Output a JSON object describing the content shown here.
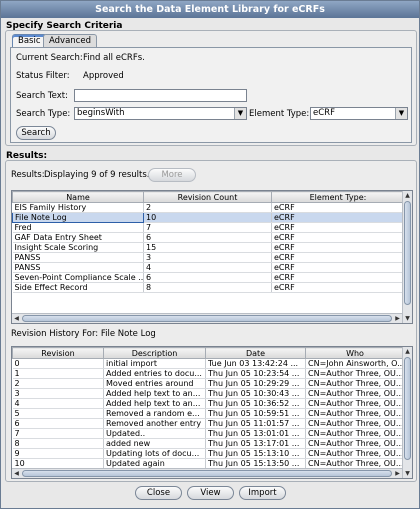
{
  "window": {
    "title": "Search the Data Element Library for eCRFs"
  },
  "criteria": {
    "title": "Specify Search Criteria",
    "tabs": [
      {
        "label": "Basic"
      },
      {
        "label": "Advanced"
      }
    ],
    "current_search_label": "Current Search:",
    "current_search_value": "Find all eCRFs.",
    "status_filter_label": "Status Filter:",
    "status_filter_value": "Approved",
    "search_text_label": "Search Text:",
    "search_text_value": "",
    "search_type_label": "Search Type:",
    "search_type_value": "beginsWith",
    "element_type_label": "Element Type:",
    "element_type_value": "eCRF",
    "search_button": "Search"
  },
  "results": {
    "title": "Results:",
    "summary_label": "Results:",
    "summary_value": "Displaying 9 of 9 results.",
    "more_button": "More",
    "columns": [
      "Name",
      "Revision Count",
      "Element Type:"
    ],
    "rows": [
      [
        "EIS Family History",
        "2",
        "eCRF"
      ],
      [
        "File Note Log",
        "10",
        "eCRF"
      ],
      [
        "Fred",
        "7",
        "eCRF"
      ],
      [
        "GAF Data Entry Sheet",
        "6",
        "eCRF"
      ],
      [
        "Insight Scale Scoring",
        "15",
        "eCRF"
      ],
      [
        "PANSS",
        "3",
        "eCRF"
      ],
      [
        "PANSS",
        "4",
        "eCRF"
      ],
      [
        "Seven-Point Compliance Scale ...",
        "6",
        "eCRF"
      ],
      [
        "Side Effect Record",
        "8",
        "eCRF"
      ]
    ],
    "selected_row": 1
  },
  "history": {
    "label": "Revision History For: File Note Log",
    "columns": [
      "Revision",
      "Description",
      "Date",
      "Who"
    ],
    "rows": [
      [
        "0",
        "initial import",
        "Tue Jun 03 13:42:24 ...",
        "CN=John Ainsworth, O..."
      ],
      [
        "1",
        "Added entries to docu...",
        "Thu Jun 05 10:23:54 ...",
        "CN=Author Three, OU..."
      ],
      [
        "2",
        "Moved entries around",
        "Thu Jun 05 10:29:29 ...",
        "CN=Author Three, OU..."
      ],
      [
        "3",
        "Added help text to an...",
        "Thu Jun 05 10:30:43 ...",
        "CN=Author Three, OU..."
      ],
      [
        "4",
        "Added help text to an...",
        "Thu Jun 05 10:36:52 ...",
        "CN=Author Three, OU..."
      ],
      [
        "5",
        "Removed a random e...",
        "Thu Jun 05 10:59:51 ...",
        "CN=Author Three, OU..."
      ],
      [
        "6",
        "Removed another entry",
        "Thu Jun 05 11:01:57 ...",
        "CN=Author Three, OU..."
      ],
      [
        "7",
        "Updated..",
        "Thu Jun 05 13:01:01 ...",
        "CN=Author Three, OU..."
      ],
      [
        "8",
        "added new",
        "Thu Jun 05 13:17:01 ...",
        "CN=Author Three, OU..."
      ],
      [
        "9",
        "Updating lots of docu...",
        "Thu Jun 05 15:13:10 ...",
        "CN=Author Three, OU..."
      ],
      [
        "10",
        "Updated again",
        "Thu Jun 05 15:13:50 ...",
        "CN=Author Three, OU..."
      ]
    ]
  },
  "footer": {
    "close_button": "Close",
    "view_button": "View",
    "import_button": "Import"
  }
}
